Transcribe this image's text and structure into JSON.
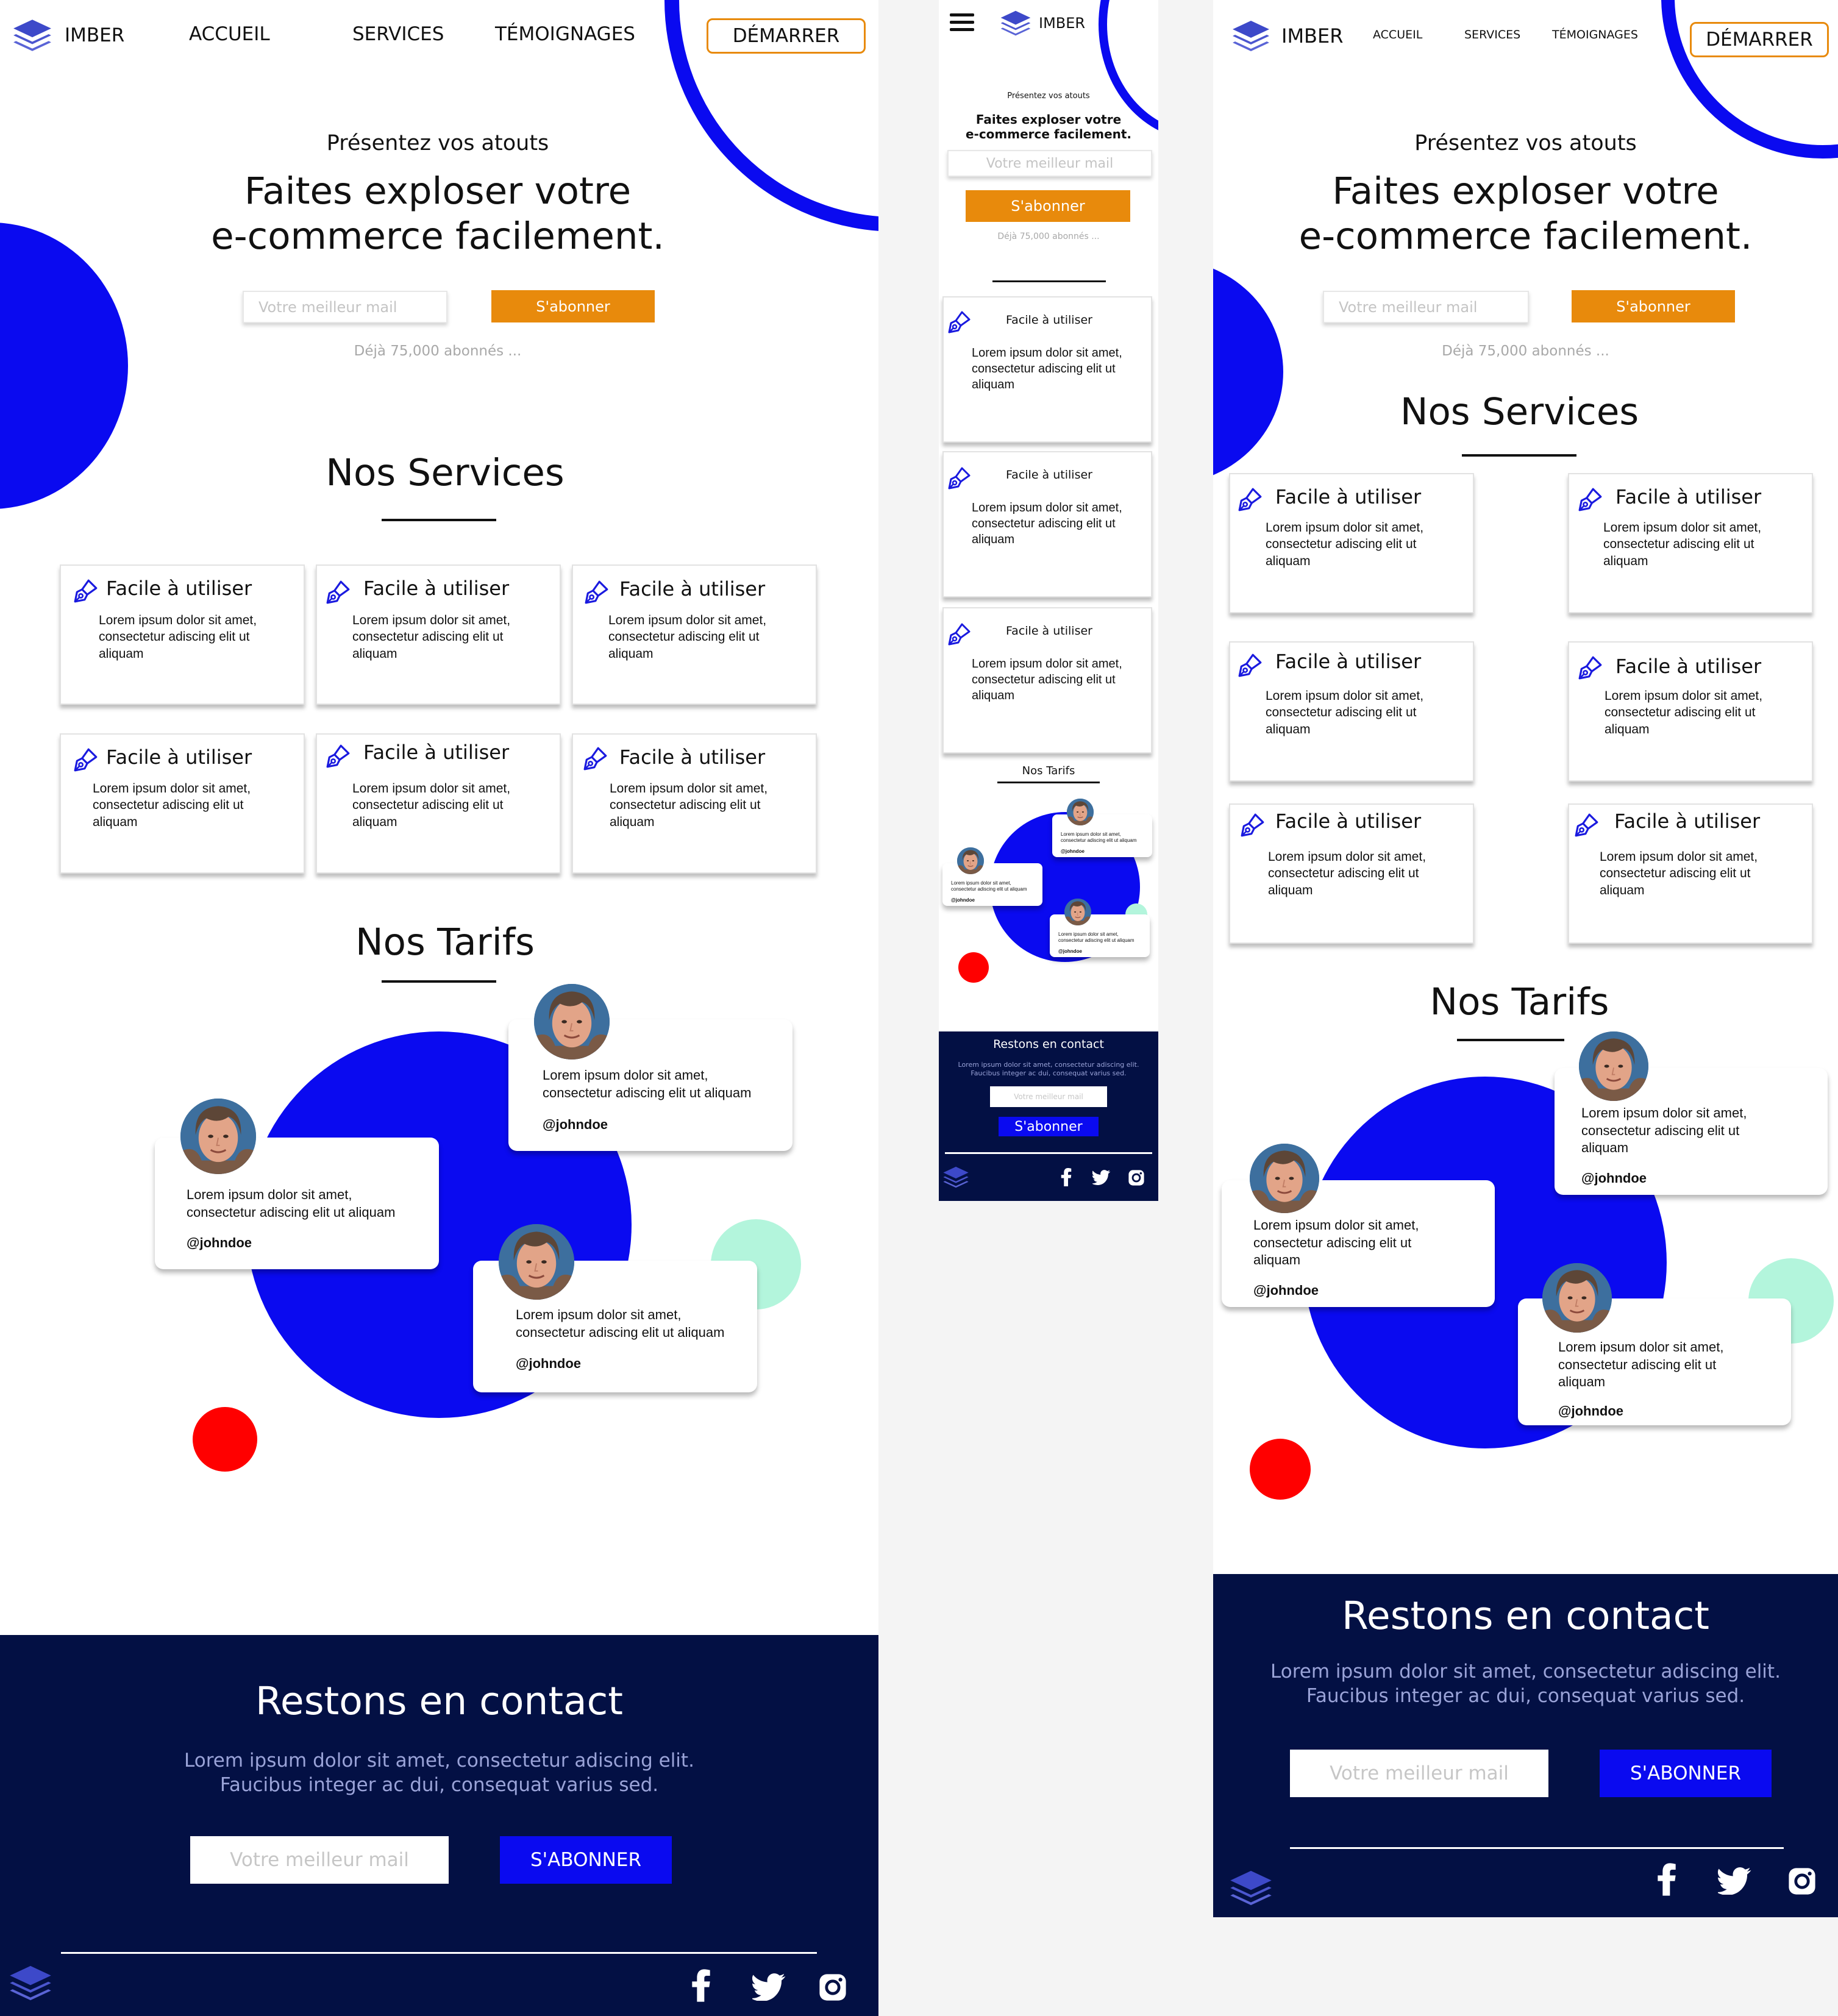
{
  "brand": {
    "name": "IMBER"
  },
  "nav": {
    "home": "ACCUEIL",
    "services": "SERVICES",
    "testimonials": "TÉMOIGNAGES",
    "cta": "DÉMARRER"
  },
  "hero": {
    "eyebrow": "Présentez vos atouts",
    "title_line1": "Faites exploser votre",
    "title_line2": "e-commerce facilement.",
    "email_placeholder": "Votre meilleur mail",
    "subscribe": "S'abonner",
    "subscribers": "Déjà 75,000 abonnés ..."
  },
  "services": {
    "title": "Nos Services",
    "card_title": "Facile à utiliser",
    "card_line1": "Lorem ipsum dolor sit amet,",
    "card_line2": "consectetur adiscing elit ut",
    "card_line3": "aliquam"
  },
  "pricing": {
    "title": "Nos Tarifs",
    "mobile_title": "Nos Tarifs",
    "testimonial_line1": "Lorem ipsum dolor sit amet,",
    "testimonial_line2": "consectetur adiscing elit ut aliquam",
    "testimonial_line2a": "consectetur adiscing elit ut",
    "testimonial_line3": "aliquam",
    "handle": "@johndoe"
  },
  "footer": {
    "title": "Restons en contact",
    "line1": "Lorem ipsum dolor sit amet, consectetur adiscing elit.",
    "line2": "Faucibus integer ac dui, consequat varius sed.",
    "email_placeholder": "Votre meilleur mail",
    "subscribe": "S'ABONNER",
    "subscribe_mobile": "S'abonner"
  },
  "colors": {
    "accent_blue": "#0a0af0",
    "orange": "#e88a0c",
    "navy": "#031044",
    "red": "#ff0000",
    "mint": "#b3f5dc"
  },
  "icons": [
    "layers-logo-icon",
    "pen-nib-icon",
    "facebook-icon",
    "twitter-icon",
    "instagram-icon",
    "hamburger-menu-icon"
  ]
}
